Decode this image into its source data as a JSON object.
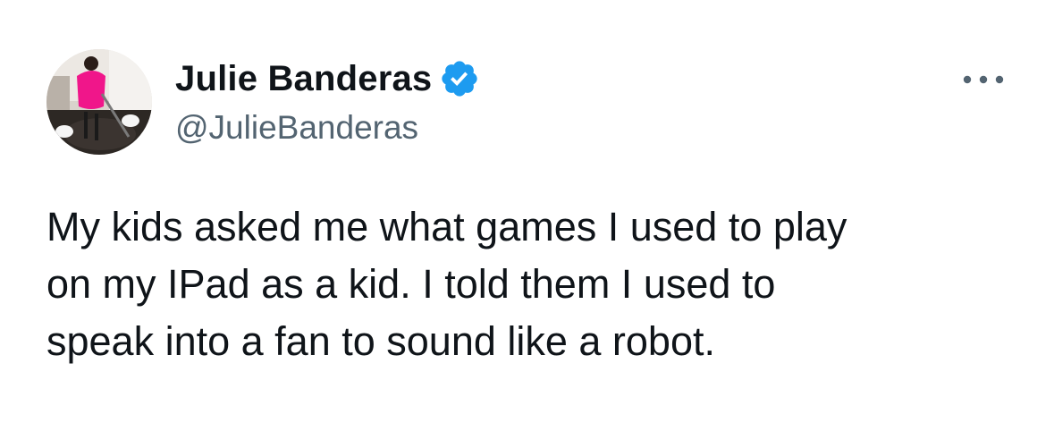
{
  "author": {
    "display_name": "Julie Banderas",
    "handle": "@JulieBanderas",
    "verified": true,
    "avatar_icon": "profile-photo-avatar"
  },
  "more_icon": "more-options-icon",
  "tweet": {
    "text": "My kids asked me what games I used to play\non my IPad as a kid. I told them I used to\nspeak into a fan to sound like a robot."
  },
  "colors": {
    "text_primary": "#0f1419",
    "text_secondary": "#536471",
    "verified_blue": "#1d9bf0",
    "background": "#ffffff"
  }
}
